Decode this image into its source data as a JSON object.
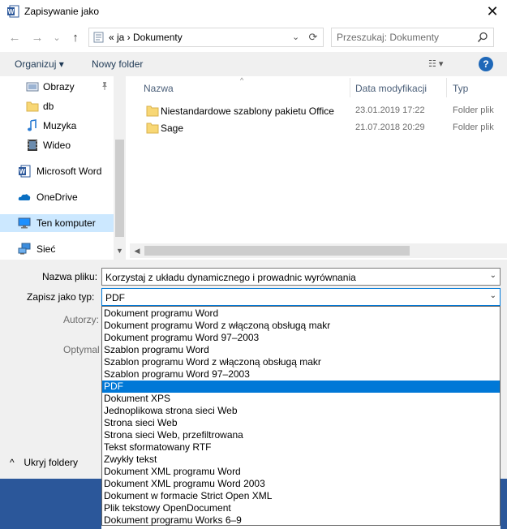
{
  "window": {
    "title": "Zapisywanie jako",
    "close_glyph": "✕",
    "icon": "word-app-icon"
  },
  "nav": {
    "back_glyph": "←",
    "forward_glyph": "→",
    "recent_glyph": "⌄",
    "up_glyph": "↑",
    "address": "«  ja  ›  Dokumenty",
    "address_chevron": "⌄",
    "refresh_glyph": "⟳",
    "search_placeholder": "Przeszukaj: Dokumenty"
  },
  "toolbar": {
    "organize_label": "Organizuj ▾",
    "new_folder_label": "Nowy folder",
    "view_glyph": "☷ ▾",
    "help_glyph": "?"
  },
  "sidebar": {
    "items": [
      {
        "label": "Obrazy",
        "icon": "pictures-icon"
      },
      {
        "label": "db",
        "icon": "folder-icon"
      },
      {
        "label": "Muzyka",
        "icon": "music-icon"
      },
      {
        "label": "Wideo",
        "icon": "video-icon"
      },
      {
        "label": "Microsoft Word",
        "icon": "word-icon"
      },
      {
        "label": "OneDrive",
        "icon": "onedrive-icon"
      },
      {
        "label": "Ten komputer",
        "icon": "computer-icon",
        "selected": true
      },
      {
        "label": "Sieć",
        "icon": "network-icon"
      }
    ]
  },
  "filelist": {
    "columns": [
      "Nazwa",
      "Data modyfikacji",
      "Typ"
    ],
    "rows": [
      {
        "name": "Niestandardowe szablony pakietu Office",
        "date": "23.01.2019 17:22",
        "type": "Folder plików"
      },
      {
        "name": "Sage",
        "date": "21.07.2018 20:29",
        "type": "Folder plików"
      }
    ]
  },
  "form": {
    "filename_label": "Nazwa pliku:",
    "filename_value": "Korzystaj z układu dynamicznego i prowadnic wyrównania",
    "filetype_label": "Zapisz jako typ:",
    "filetype_value": "PDF",
    "authors_label": "Autorzy:",
    "optimize_label": "Optymal",
    "hide_folders_label": "Ukryj foldery",
    "hide_folders_glyph": "^"
  },
  "filetype_options": [
    "Dokument programu Word",
    "Dokument programu Word z włączoną obsługą makr",
    "Dokument programu Word 97–2003",
    "Szablon programu Word",
    "Szablon programu Word z włączoną obsługą makr",
    "Szablon programu Word 97–2003",
    "PDF",
    "Dokument XPS",
    "Jednoplikowa strona sieci Web",
    "Strona sieci Web",
    "Strona sieci Web, przefiltrowana",
    "Tekst sformatowany RTF",
    "Zwykły tekst",
    "Dokument XML programu Word",
    "Dokument XML programu Word 2003",
    "Dokument w formacie Strict Open XML",
    "Plik tekstowy OpenDocument",
    "Dokument programu Works 6–9"
  ],
  "selected_option_index": 6,
  "colors": {
    "accent": "#0078d7",
    "selection": "#cce8ff",
    "word_blue": "#2b579a",
    "folder": "#f8d775"
  }
}
